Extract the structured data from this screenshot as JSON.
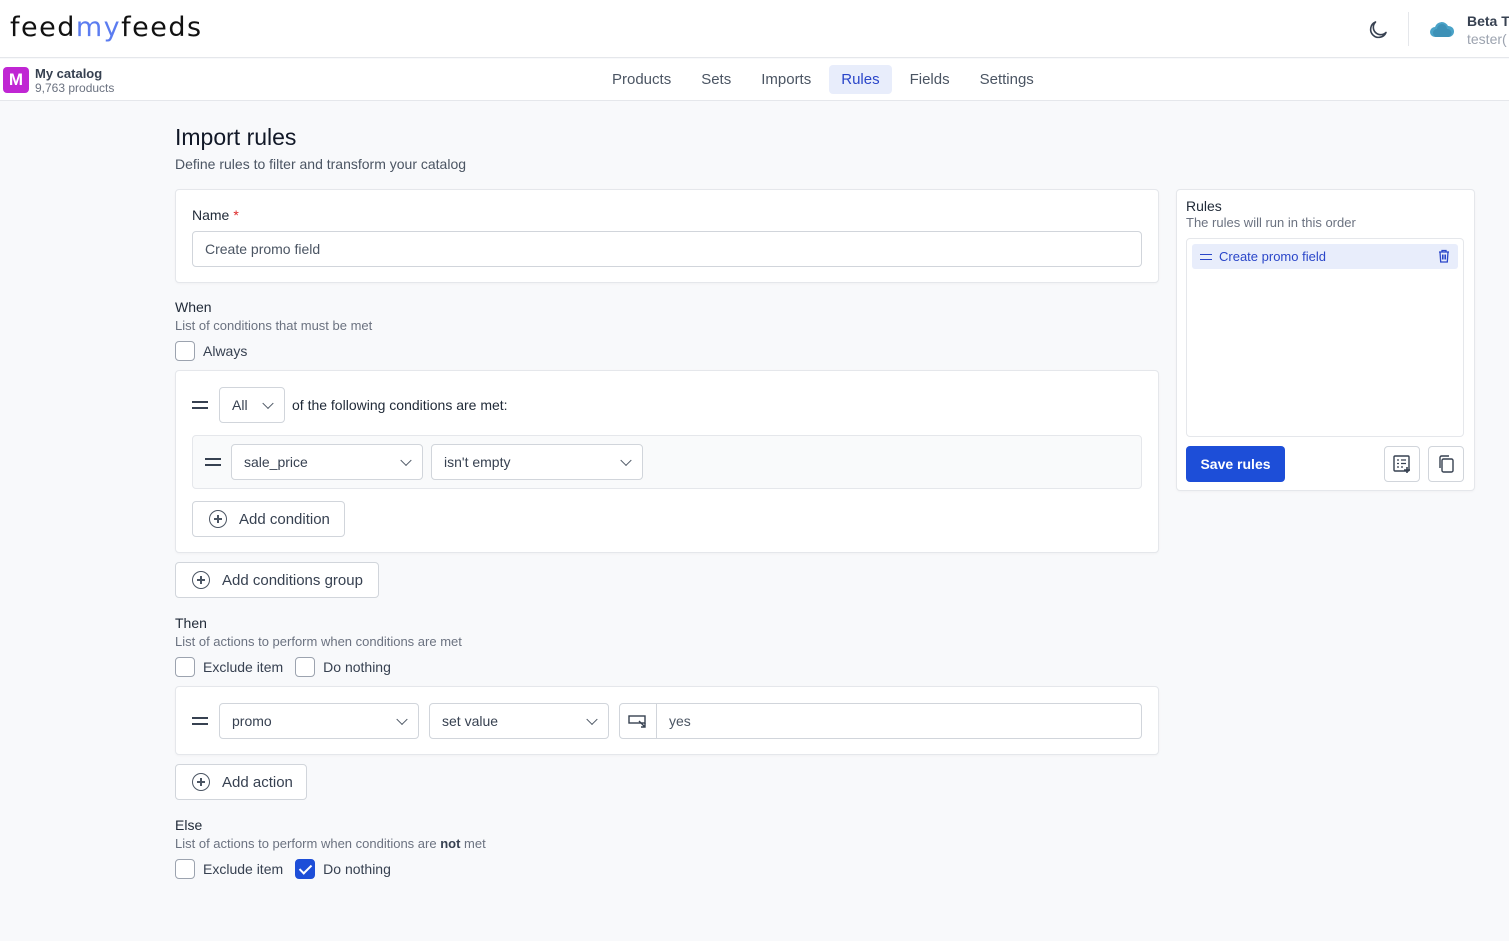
{
  "header": {
    "logo_left": "feed",
    "logo_mid": "my",
    "logo_right": "feeds",
    "theme_toggle_icon": "moon-icon",
    "user": {
      "name": "Beta T",
      "email": "tester("
    }
  },
  "catalog": {
    "badge": "M",
    "name": "My catalog",
    "count": "9,763 products"
  },
  "nav": {
    "tabs": [
      {
        "label": "Products",
        "active": false
      },
      {
        "label": "Sets",
        "active": false
      },
      {
        "label": "Imports",
        "active": false
      },
      {
        "label": "Rules",
        "active": true
      },
      {
        "label": "Fields",
        "active": false
      },
      {
        "label": "Settings",
        "active": false
      }
    ]
  },
  "page": {
    "title": "Import rules",
    "subtitle": "Define rules to filter and transform your catalog"
  },
  "name_field": {
    "label": "Name",
    "required_mark": "*",
    "value": "Create promo field"
  },
  "when": {
    "title": "When",
    "subtitle": "List of conditions that must be met",
    "always_label": "Always",
    "always_checked": false,
    "group": {
      "match_value": "All",
      "match_text": "of the following conditions are met:",
      "conditions": [
        {
          "field": "sale_price",
          "operator": "isn't empty"
        }
      ],
      "add_condition_label": "Add condition"
    },
    "add_group_label": "Add conditions group"
  },
  "then": {
    "title": "Then",
    "subtitle": "List of actions to perform when conditions are met",
    "exclude_label": "Exclude item",
    "exclude_checked": false,
    "nothing_label": "Do nothing",
    "nothing_checked": false,
    "actions": [
      {
        "field": "promo",
        "operation": "set value",
        "value": "yes"
      }
    ],
    "add_action_label": "Add action"
  },
  "else": {
    "title": "Else",
    "subtitle_pre": "List of actions to perform when conditions are ",
    "subtitle_bold": "not",
    "subtitle_post": " met",
    "exclude_label": "Exclude item",
    "exclude_checked": false,
    "nothing_label": "Do nothing",
    "nothing_checked": true
  },
  "rules_panel": {
    "title": "Rules",
    "subtitle": "The rules will run in this order",
    "items": [
      {
        "label": "Create promo field"
      }
    ],
    "save_label": "Save rules"
  },
  "colors": {
    "accent": "#1d4ed8",
    "badge": "#c026d3",
    "active_tab_bg": "#e8edfb"
  }
}
